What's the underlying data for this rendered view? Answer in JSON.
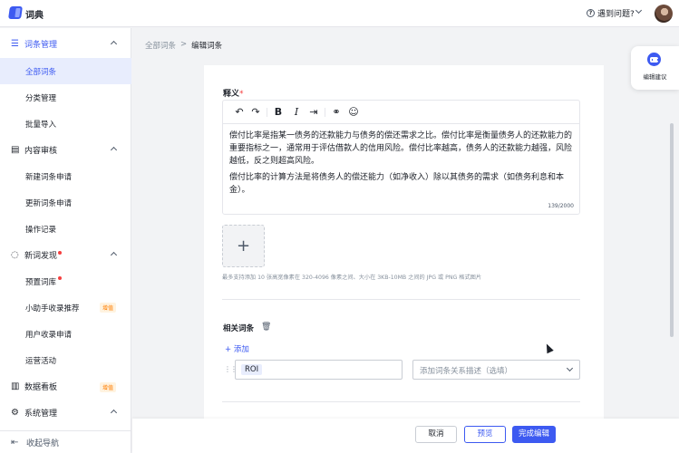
{
  "app": {
    "title": "词典"
  },
  "header": {
    "help_label": "遇到问题?"
  },
  "sidebar": {
    "groups": [
      {
        "label": "词条管理",
        "items": [
          {
            "label": "全部词条"
          },
          {
            "label": "分类管理"
          },
          {
            "label": "批量导入"
          }
        ]
      },
      {
        "label": "内容审核",
        "items": [
          {
            "label": "新建词条申请"
          },
          {
            "label": "更新词条申请"
          },
          {
            "label": "操作记录"
          }
        ]
      },
      {
        "label": "新词发现",
        "items": [
          {
            "label": "预置词库"
          },
          {
            "label": "小助手收录推荐",
            "badge": "增值"
          },
          {
            "label": "用户收录申请"
          },
          {
            "label": "运营活动"
          }
        ]
      },
      {
        "label": "数据看板",
        "badge": "增值"
      },
      {
        "label": "系统管理"
      }
    ],
    "collapse_label": "收起导航"
  },
  "breadcrumb": {
    "root": "全部词条",
    "separator": ">",
    "current": "编辑词条"
  },
  "form": {
    "definition_label": "释义",
    "required_mark": "*",
    "editor": {
      "paragraph_1": "偿付比率是指某一债务的还款能力与债务的偿还需求之比。偿付比率是衡量债务人的还款能力的重要指标之一，通常用于评估借款人的信用风险。偿付比率越高，债务人的还款能力越强，风险越低，反之则超高风险。",
      "paragraph_2": "偿付比率的计算方法是将债务人的偿还能力（如净收入）除以其债务的需求（如债务利息和本金）。",
      "char_count": "139/2000"
    },
    "upload": {
      "plus": "+",
      "hint": "最多支持添加 10 张高宽像素在 320-4096 像素之间、大小在 3KB-10MB 之间的 JPG 或 PNG 格式图片"
    },
    "related": {
      "title": "相关词条",
      "add_label": "+ 添加",
      "term_value": "ROI",
      "relation_placeholder": "添加词条关系描述（选填）"
    }
  },
  "actions": {
    "cancel": "取消",
    "preview": "预览",
    "done": "完成编辑"
  },
  "float_suggest": {
    "label": "编辑建议"
  },
  "colors": {
    "accent": "#3d5af1",
    "danger": "#f53f3f",
    "badge": "#ff7d00"
  }
}
